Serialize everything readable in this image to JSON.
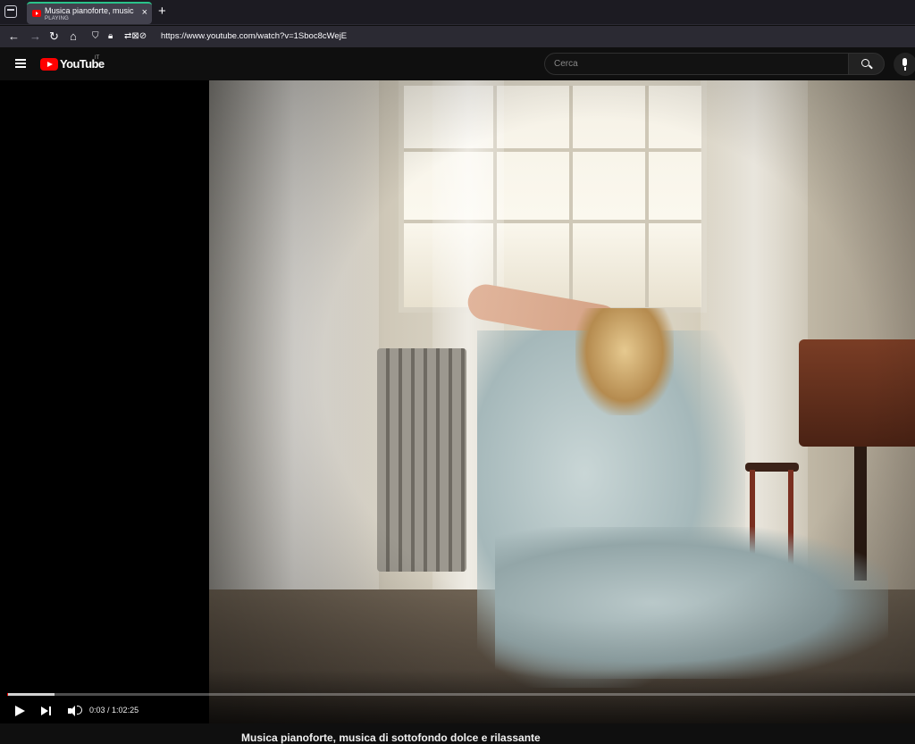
{
  "browser": {
    "tab": {
      "title": "Musica pianoforte, musica di sottofondo dolce e rilassante",
      "status": "PLAYING",
      "close_label": "×"
    },
    "new_tab_label": "+",
    "nav": {
      "back": "←",
      "forward": "→",
      "reload": "↻",
      "home": "⌂"
    },
    "url": "https://www.youtube.com/watch?v=1Sboc8cWejE"
  },
  "youtube": {
    "logo_text": "YouTube",
    "country_code": "IT",
    "search": {
      "placeholder": "Cerca",
      "value": ""
    }
  },
  "player": {
    "progress_fraction": 0.0005,
    "buffered_fraction": 0.052,
    "current_time": "0:03",
    "separator": " / ",
    "duration": "1:02:25"
  },
  "video": {
    "title": "Musica pianoforte, musica di sottofondo dolce e rilassante"
  },
  "colors": {
    "brand_red": "#ff0000",
    "tab_accent": "#2ac38a",
    "background": "#0f0f0f"
  },
  "icons": [
    "tab-list-icon",
    "youtube-favicon",
    "close-icon",
    "new-tab-icon",
    "back-icon",
    "forward-icon",
    "reload-icon",
    "home-icon",
    "shield-icon",
    "lock-icon",
    "permissions-icon",
    "menu-icon",
    "youtube-logo",
    "search-icon",
    "microphone-icon",
    "play-icon",
    "next-icon",
    "volume-icon"
  ]
}
